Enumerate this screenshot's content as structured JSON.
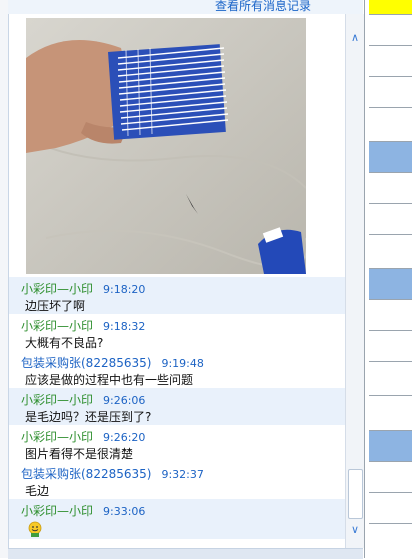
{
  "header": {
    "history_link": "查看所有消息记录"
  },
  "messages": [
    {
      "sender": "小彩印—小印",
      "time": "9:18:20",
      "text": "边压坏了啊",
      "sender_color": "#2f8f2f",
      "highlight": true
    },
    {
      "sender": "小彩印—小印",
      "time": "9:18:32",
      "text": "大概有不良品?",
      "sender_color": "#2f8f2f",
      "highlight": false
    },
    {
      "sender": "包装采购张(82285635)",
      "time": "9:19:48",
      "text": "应该是做的过程中也有一些问题",
      "sender_color": "#1d63c4",
      "highlight": false
    },
    {
      "sender": "小彩印—小印",
      "time": "9:26:06",
      "text": "是毛边吗？还是压到了?",
      "sender_color": "#2f8f2f",
      "highlight": true
    },
    {
      "sender": "小彩印—小印",
      "time": "9:26:20",
      "text": "图片看得不是很清楚",
      "sender_color": "#2f8f2f",
      "highlight": false
    },
    {
      "sender": "包装采购张(82285635)",
      "time": "9:32:37",
      "text": "毛边",
      "sender_color": "#1d63c4",
      "highlight": false
    },
    {
      "sender": "小彩印—小印",
      "time": "9:33:06",
      "text": "",
      "sender_color": "#2f8f2f",
      "highlight": true,
      "emoji": "smiley-emoji-icon"
    }
  ],
  "photo": {
    "description_icon": "photo-of-cards-icon"
  },
  "spreadsheet": {
    "colors": {
      "yellow": "#ffff00",
      "blue": "#8db4e2",
      "white": "#ffffff"
    }
  }
}
